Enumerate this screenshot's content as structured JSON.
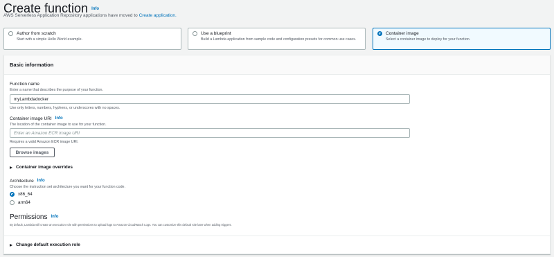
{
  "page": {
    "title": "Create function",
    "title_info": "Info",
    "notice_text": "AWS Serverless Application Repository applications have moved to ",
    "notice_link": "Create application."
  },
  "options": [
    {
      "label": "Author from scratch",
      "desc": "Start with a simple Hello World example.",
      "selected": false
    },
    {
      "label": "Use a blueprint",
      "desc": "Build a Lambda application from sample code and configuration presets for common use cases.",
      "selected": false
    },
    {
      "label": "Container image",
      "desc": "Select a container image to deploy for your function.",
      "selected": true
    }
  ],
  "basic": {
    "header": "Basic information",
    "fn_label": "Function name",
    "fn_hint": "Enter a name that describes the purpose of your function.",
    "fn_value": "myLambdadocker",
    "fn_constraint": "Use only letters, numbers, hyphens, or underscores with no spaces.",
    "uri_label": "Container image URI",
    "uri_info": "Info",
    "uri_hint": "The location of the container image to use for your function.",
    "uri_placeholder": "Enter an Amazon ECR image URI",
    "uri_constraint": "Requires a valid Amazon ECR image URI.",
    "browse_label": "Browse images",
    "overrides_label": "Container image overrides",
    "arch_label": "Architecture",
    "arch_info": "Info",
    "arch_hint": "Choose the instruction set architecture you want for your function code.",
    "arch_options": [
      {
        "label": "x86_64",
        "selected": true
      },
      {
        "label": "arm64",
        "selected": false
      }
    ],
    "perm_title": "Permissions",
    "perm_info": "Info",
    "perm_desc": "By default, Lambda will create an execution role with permissions to upload logs to Amazon CloudWatch Logs. You can customize this default role later when adding triggers.",
    "exec_role_label": "Change default execution role"
  },
  "colors": {
    "accent": "#0073bb",
    "selected_bg": "#f1faff",
    "border": "#aab7b8"
  }
}
